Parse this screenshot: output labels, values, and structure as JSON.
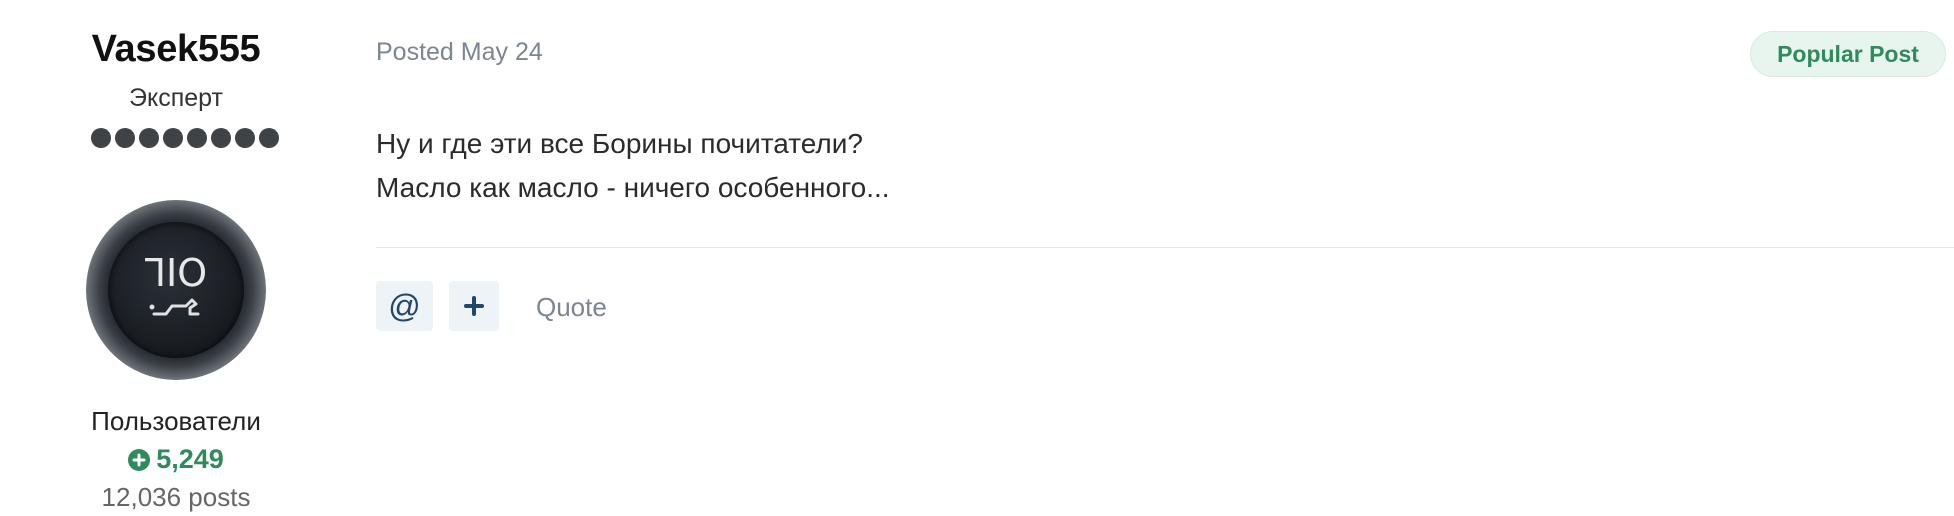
{
  "author": {
    "username": "Vasek555",
    "rank": "Эксперт",
    "rank_pips": 8,
    "avatar_text": "OIL",
    "group": "Пользователи",
    "reputation": "5,249",
    "post_count": "12,036 posts"
  },
  "post": {
    "posted_label": "Posted May 24",
    "badge": "Popular Post",
    "lines": [
      "Ну и где эти все Борины почитатели?",
      "Масло как масло - ничего особенного..."
    ]
  },
  "actions": {
    "mention_symbol": "@",
    "quote_label": "Quote"
  },
  "colors": {
    "accent_green": "#2f8a5c",
    "button_bg": "#edf3f7",
    "button_fg": "#23466b"
  },
  "icons": {
    "mention": "at-sign-icon",
    "multiquote": "plus-icon",
    "reputation": "plus-circle-icon"
  }
}
